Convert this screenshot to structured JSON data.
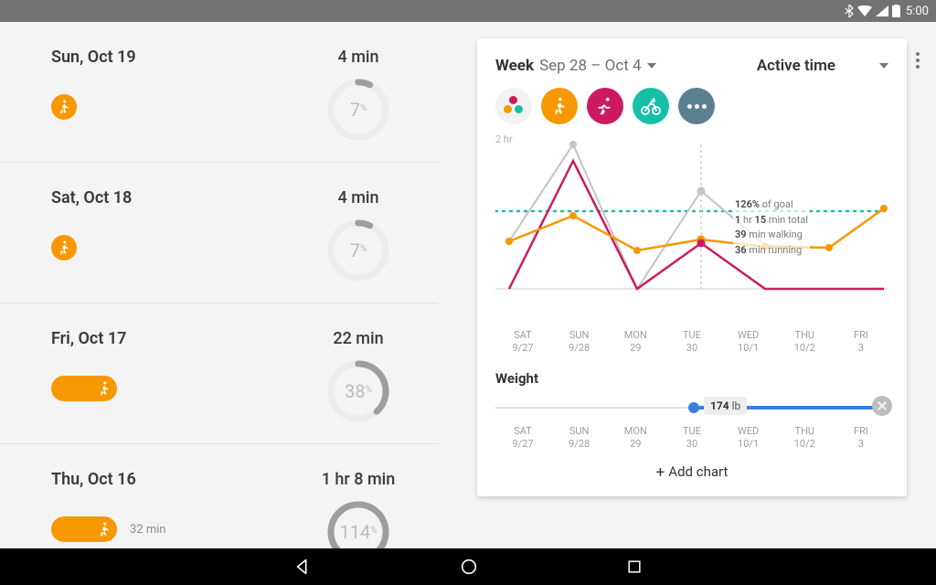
{
  "status": {
    "time": "5:00"
  },
  "days": [
    {
      "date": "Sun, Oct 19",
      "total": "4 min",
      "pct": 7,
      "pill_width": "small",
      "extra": ""
    },
    {
      "date": "Sat, Oct 18",
      "total": "4 min",
      "pct": 7,
      "pill_width": "small",
      "extra": ""
    },
    {
      "date": "Fri, Oct 17",
      "total": "22 min",
      "pct": 38,
      "pill_width": "wide",
      "extra": ""
    },
    {
      "date": "Thu, Oct 16",
      "total": "1 hr 8 min",
      "pct": 114,
      "pill_width": "wide",
      "extra": "32 min"
    }
  ],
  "card": {
    "range_prefix": "Week",
    "range_value": "Sep 28 – Oct 4",
    "metric": "Active time",
    "y_label": "2 hr",
    "tooltip": {
      "pct": "126%",
      "pct_tail": " of goal",
      "l2a": "1",
      "l2b": " hr ",
      "l2c": "15",
      "l2d": " min total",
      "l3a": "39",
      "l3b": " min walking",
      "l4a": "36",
      "l4b": " min running"
    },
    "weight": {
      "title": "Weight",
      "value": "174",
      "unit": "lb"
    },
    "add_chart": "Add chart",
    "categories": [
      {
        "top": "SAT",
        "bot": "9/27"
      },
      {
        "top": "SUN",
        "bot": "9/28"
      },
      {
        "top": "MON",
        "bot": "29"
      },
      {
        "top": "TUE",
        "bot": "30"
      },
      {
        "top": "WED",
        "bot": "10/1"
      },
      {
        "top": "THU",
        "bot": "10/2"
      },
      {
        "top": "FRI",
        "bot": "3"
      }
    ]
  },
  "chart_data": {
    "type": "line",
    "title": "Active time – Week Sep 28–Oct 4",
    "xlabel": "",
    "ylabel": "Active time (min)",
    "ylim": [
      0,
      120
    ],
    "goal_line": 60,
    "categories": [
      "SAT 9/27",
      "SUN 9/28",
      "MON 29",
      "TUE 30",
      "WED 10/1",
      "THU 10/2",
      "FRI 3"
    ],
    "series": [
      {
        "name": "Total",
        "color": "#c4c4c4",
        "values": [
          37,
          115,
          0,
          75,
          35,
          33,
          62
        ]
      },
      {
        "name": "Walking",
        "color": "#f79800",
        "values": [
          37,
          57,
          30,
          39,
          34,
          33,
          62
        ]
      },
      {
        "name": "Running",
        "color": "#cc1a60",
        "values": [
          0,
          100,
          0,
          36,
          0,
          0,
          0
        ]
      }
    ],
    "weight_series": {
      "unit": "lb",
      "categories": [
        "SAT 9/27",
        "SUN 9/28",
        "MON 29",
        "TUE 30",
        "WED 10/1",
        "THU 10/2",
        "FRI 3"
      ],
      "values": [
        null,
        null,
        null,
        174,
        null,
        null,
        null
      ]
    }
  }
}
